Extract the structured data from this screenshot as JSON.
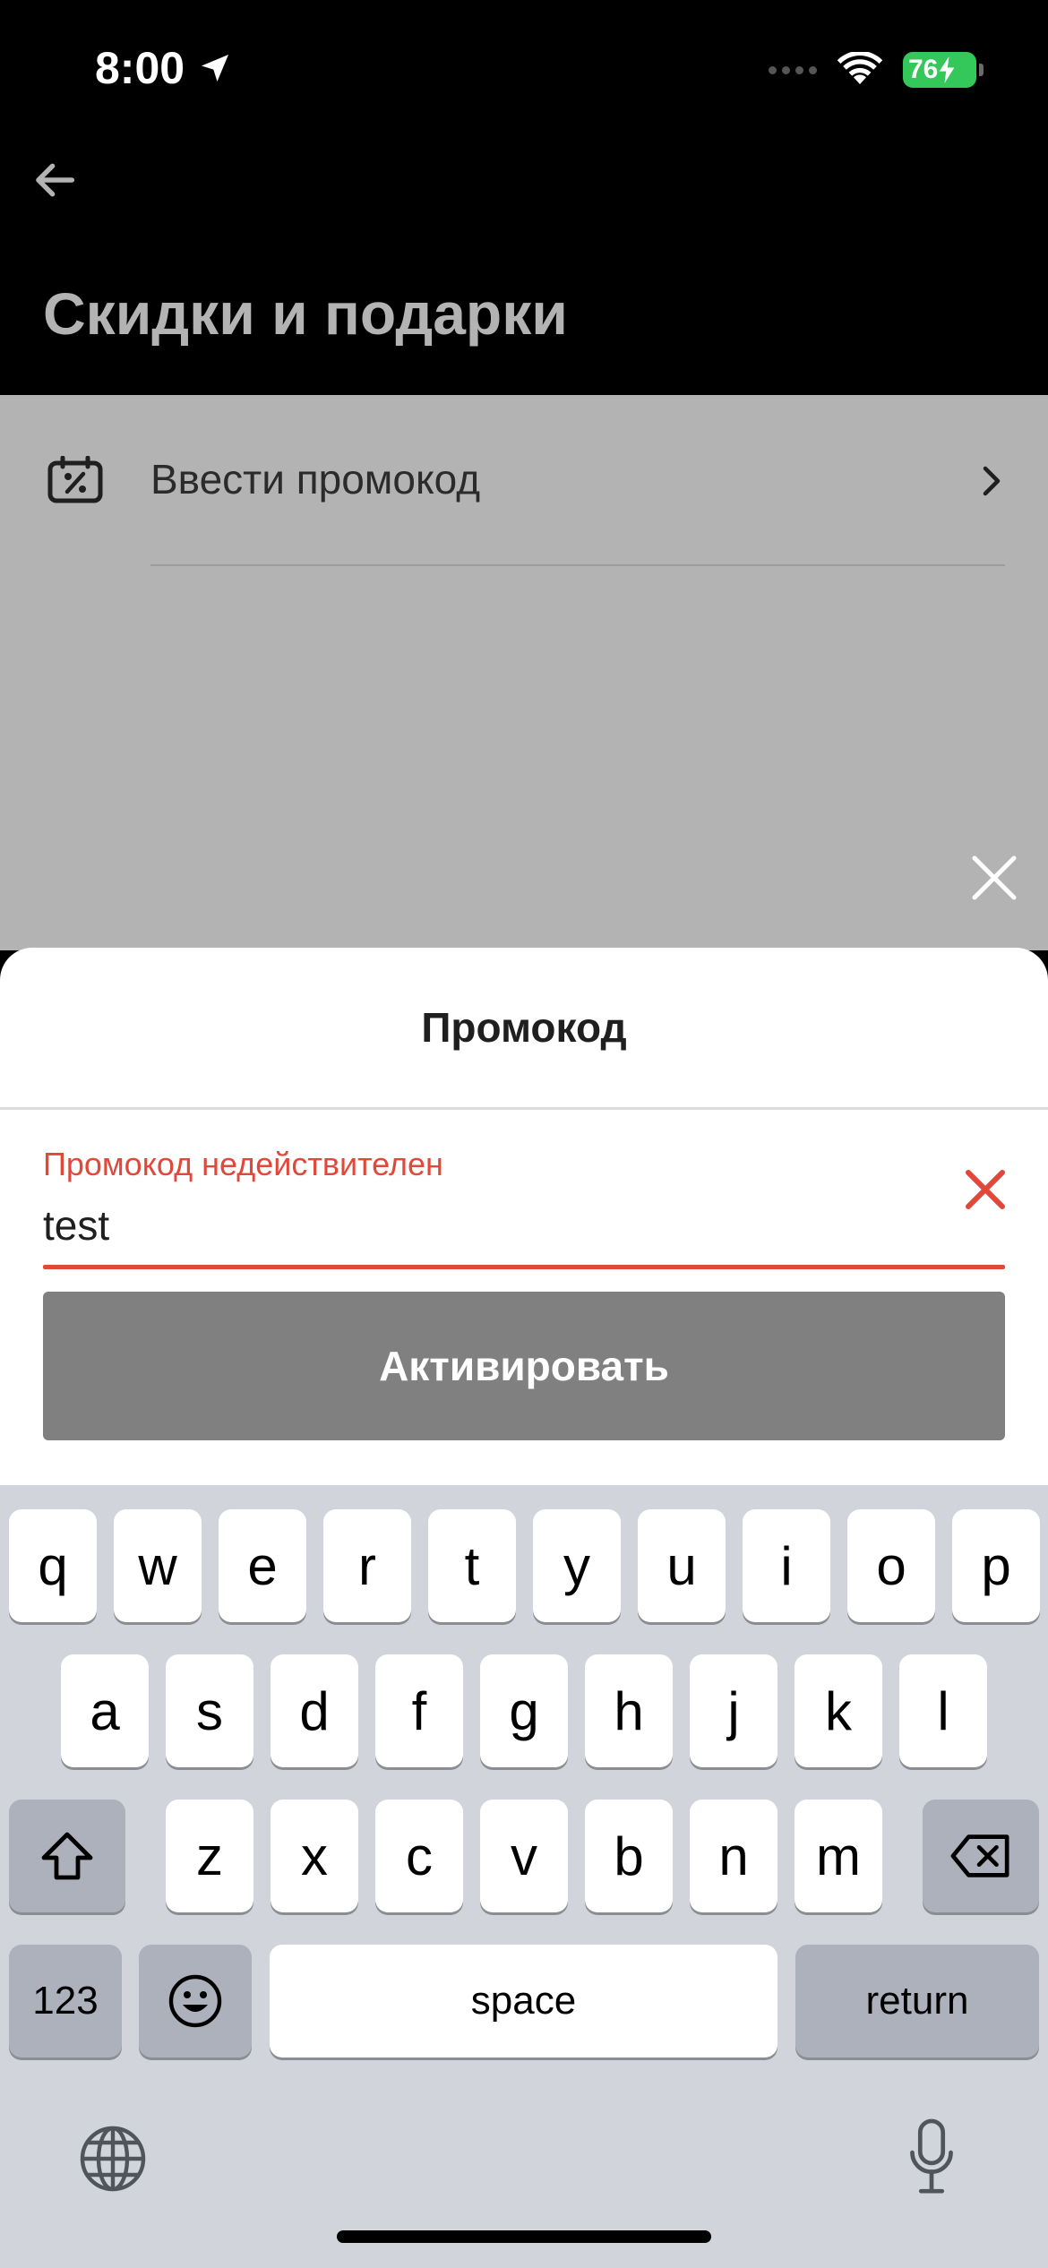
{
  "status_bar": {
    "time": "8:00",
    "battery": "76"
  },
  "background_page": {
    "title": "Скидки и подарки",
    "promo_row_label": "Ввести промокод"
  },
  "sheet": {
    "title": "Промокод",
    "error_text": "Промокод недействителен",
    "input_value": "test",
    "activate_label": "Активировать"
  },
  "colors": {
    "error": "#e0483a",
    "button_disabled": "#808080",
    "battery": "#34c759"
  },
  "keyboard": {
    "row1": [
      "q",
      "w",
      "e",
      "r",
      "t",
      "y",
      "u",
      "i",
      "o",
      "p"
    ],
    "row2": [
      "a",
      "s",
      "d",
      "f",
      "g",
      "h",
      "j",
      "k",
      "l"
    ],
    "row3": [
      "z",
      "x",
      "c",
      "v",
      "b",
      "n",
      "m"
    ],
    "numbers_label": "123",
    "space_label": "space",
    "return_label": "return"
  }
}
